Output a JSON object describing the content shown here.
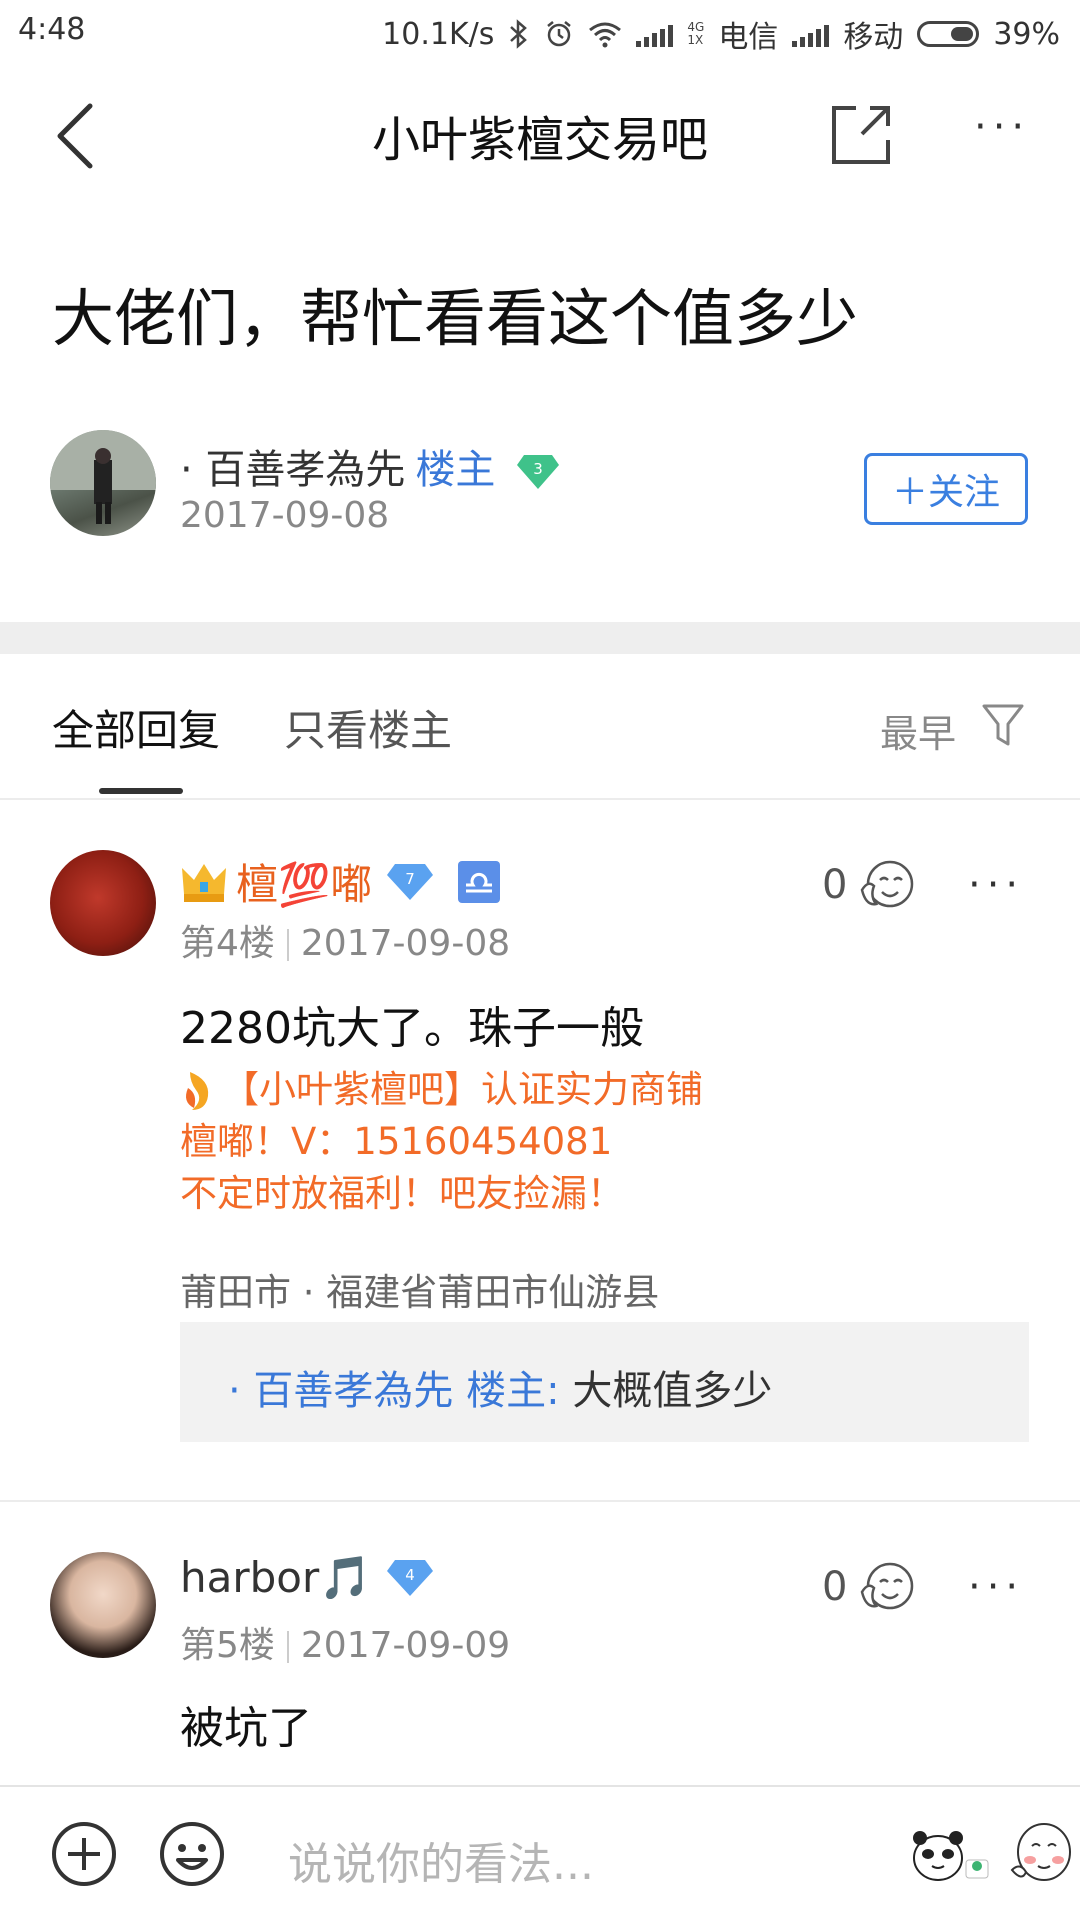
{
  "status_bar": {
    "time": "4:48",
    "speed": "10.1K/s",
    "net_small_top": "4G",
    "net_small_bottom": "1X",
    "carrier1": "电信",
    "carrier2": "移动",
    "battery": "39%"
  },
  "nav": {
    "title": "小叶紫檀交易吧"
  },
  "post": {
    "title": "大佬们，帮忙看看这个值多少",
    "author": "· 百善孝為先",
    "author_badge": "楼主",
    "author_level": "3",
    "date": "2017-09-08",
    "follow_label": "＋关注"
  },
  "tabs": {
    "all": "全部回复",
    "op_only": "只看楼主",
    "sort": "最早"
  },
  "replies": [
    {
      "name": "檀💯嘟",
      "level": "7",
      "floor": "第4楼",
      "date": "2017-09-08",
      "likes": "0",
      "text": "2280坑大了。珠子一般",
      "signature": [
        "【小叶紫檀吧】认证实力商铺",
        "檀嘟！V：15160454081",
        "不定时放福利！吧友捡漏！"
      ],
      "location": "莆田市 · 福建省莆田市仙游县",
      "quote_user": "· 百善孝為先",
      "quote_badge": "楼主",
      "quote_colon": ":",
      "quote_text": "大概值多少"
    },
    {
      "name": "harbor🎵",
      "level": "4",
      "floor": "第5楼",
      "date": "2017-09-09",
      "likes": "0",
      "text": "被坑了"
    }
  ],
  "bottom_bar": {
    "placeholder": "说说你的看法..."
  },
  "colors": {
    "accent_blue": "#3a78d8",
    "signature_orange": "#f26b28",
    "name_orange": "#e8611e"
  }
}
